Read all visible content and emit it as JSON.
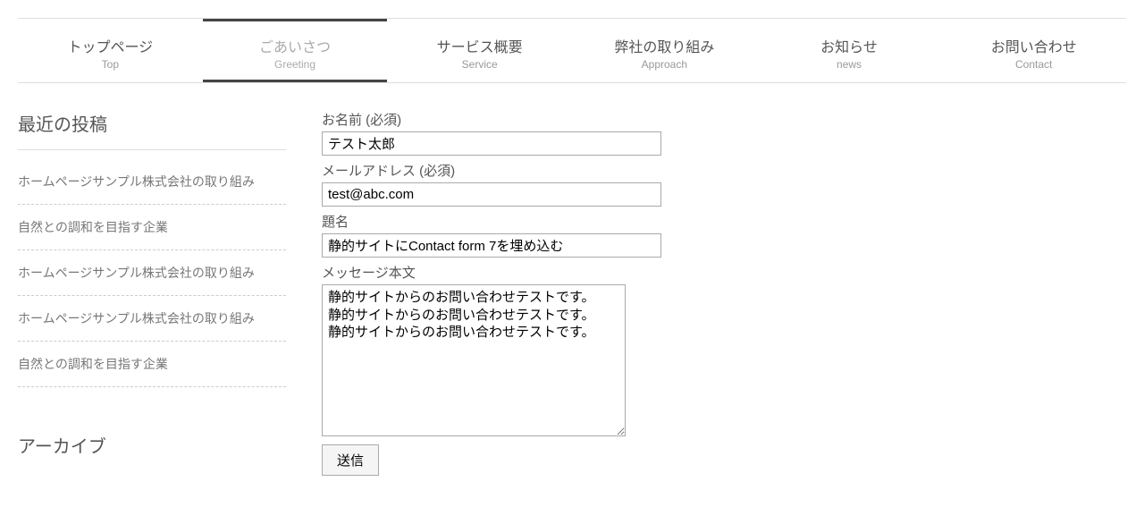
{
  "nav": [
    {
      "label": "トップページ",
      "sub": "Top",
      "active": false
    },
    {
      "label": "ごあいさつ",
      "sub": "Greeting",
      "active": true
    },
    {
      "label": "サービス概要",
      "sub": "Service",
      "active": false
    },
    {
      "label": "弊社の取り組み",
      "sub": "Approach",
      "active": false
    },
    {
      "label": "お知らせ",
      "sub": "news",
      "active": false
    },
    {
      "label": "お問い合わせ",
      "sub": "Contact",
      "active": false
    }
  ],
  "sidebar": {
    "recent_title": "最近の投稿",
    "posts": [
      "ホームページサンプル株式会社の取り組み",
      "自然との調和を目指す企業",
      "ホームページサンプル株式会社の取り組み",
      "ホームページサンプル株式会社の取り組み",
      "自然との調和を目指す企業"
    ],
    "archive_title": "アーカイブ"
  },
  "form": {
    "name_label": "お名前 (必須)",
    "name_value": "テスト太郎",
    "email_label": "メールアドレス (必須)",
    "email_value": "test@abc.com",
    "subject_label": "題名",
    "subject_value": "静的サイトにContact form 7を埋め込む",
    "message_label": "メッセージ本文",
    "message_value": "静的サイトからのお問い合わせテストです。\n静的サイトからのお問い合わせテストです。\n静的サイトからのお問い合わせテストです。",
    "submit_label": "送信"
  }
}
